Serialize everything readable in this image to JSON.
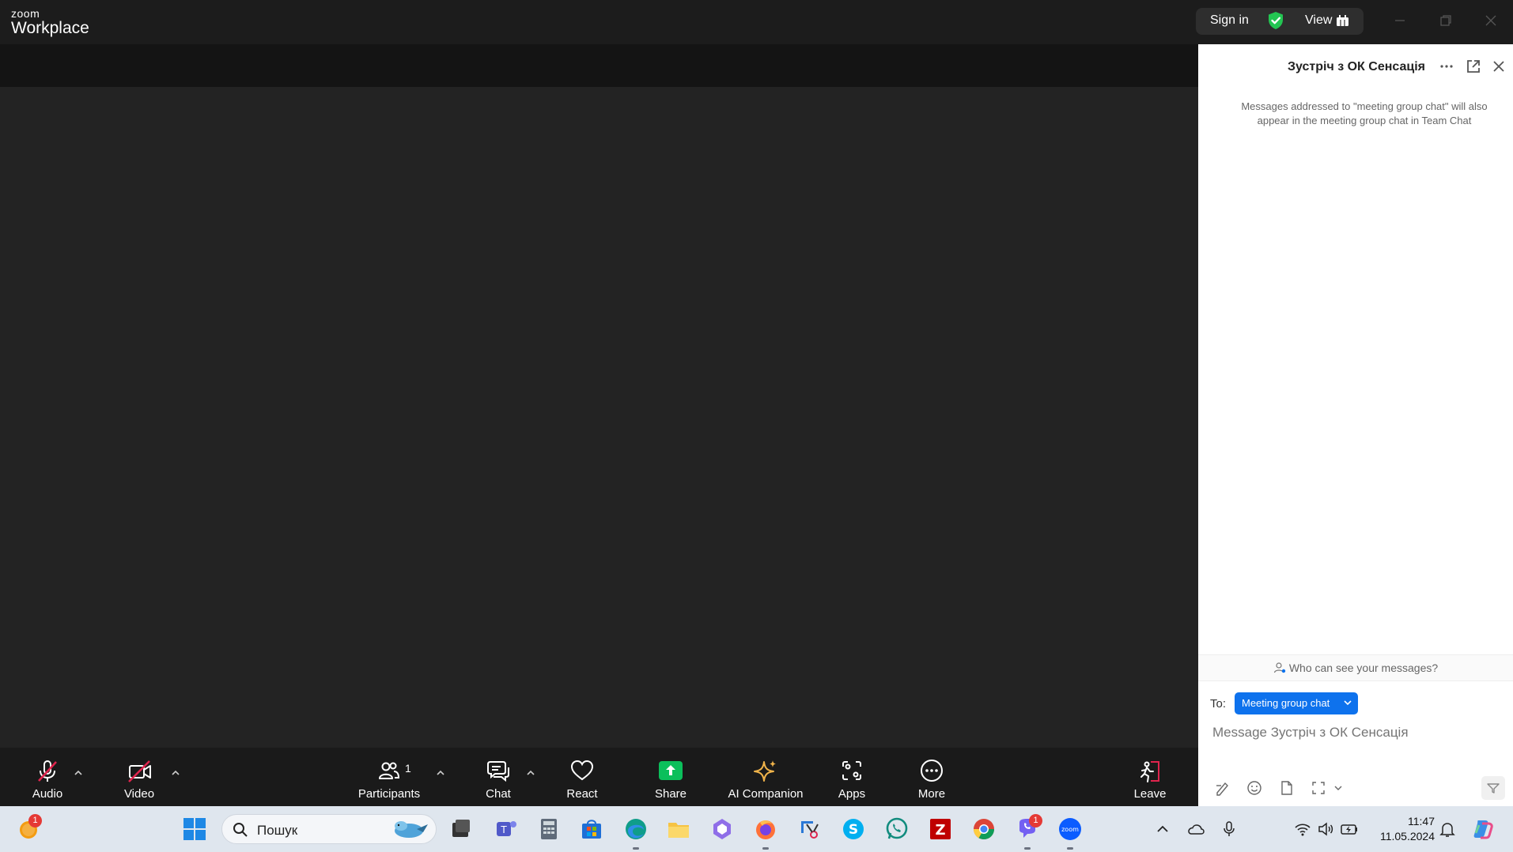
{
  "titlebar": {
    "logo_small": "zoom",
    "logo_big": "Workplace",
    "sign_in": "Sign in",
    "view": "View"
  },
  "chat": {
    "title": "Зустріч з ОК Сенсація",
    "note": "Messages addressed to \"meeting group chat\" will also appear in the meeting group chat in Team Chat",
    "who_can_see": "Who can see your messages?",
    "to_label": "To:",
    "recipient": "Meeting group chat",
    "input_placeholder": "Message Зустріч з ОК Сенсація"
  },
  "toolbar": {
    "audio": "Audio",
    "video": "Video",
    "participants": "Participants",
    "participants_count": "1",
    "chat": "Chat",
    "react": "React",
    "share": "Share",
    "ai_companion": "AI Companion",
    "apps": "Apps",
    "more": "More",
    "leave": "Leave"
  },
  "taskbar": {
    "search_placeholder": "Пошук",
    "time": "11:47",
    "date": "11.05.2024",
    "notif_badge": "1",
    "viber_badge": "1"
  },
  "colors": {
    "accent_blue": "#0e72ed",
    "share_green": "#0bbf5b",
    "muted_red": "#e0244d",
    "ai_gold": "#f0b34a"
  }
}
